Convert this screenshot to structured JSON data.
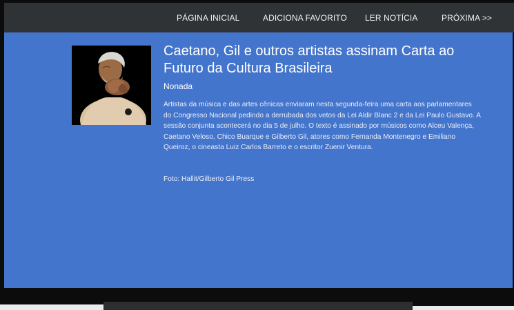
{
  "nav": {
    "home": "PÁGINA INICIAL",
    "favorite": "ADICIONA FAVORITO",
    "read": "LER NOTÍCIA",
    "next": "PRÓXIMA >>"
  },
  "article": {
    "title": "Caetano, Gil e outros artistas assinam Carta ao Futuro da Cultura Brasileira",
    "source": "Nonada",
    "summary": "Artistas da música e das artes cênicas enviaram nesta segunda-feira uma carta aos parlamentares do Congresso Nacional pedindo a derrubada dos vetos da Lei Aldir Blanc 2 e da Lei Paulo Gustavo. A sessão conjunta acontecerá no dia 5 de julho. O texto é assinado por músicos como Alceu Valença, Caetano Veloso, Chico Buarque e Gilberto Gil, atores como Fernanda Montenegro e Emiliano Queiroz, o cineasta Luiz Carlos Barreto e o escritor Zuenir Ventura.",
    "photo_credit": "Foto: Hallit/Gilberto Gil Press"
  },
  "colors": {
    "topbar": "#2f3336",
    "content_background": "#4475cc",
    "text": "#ffffff"
  }
}
